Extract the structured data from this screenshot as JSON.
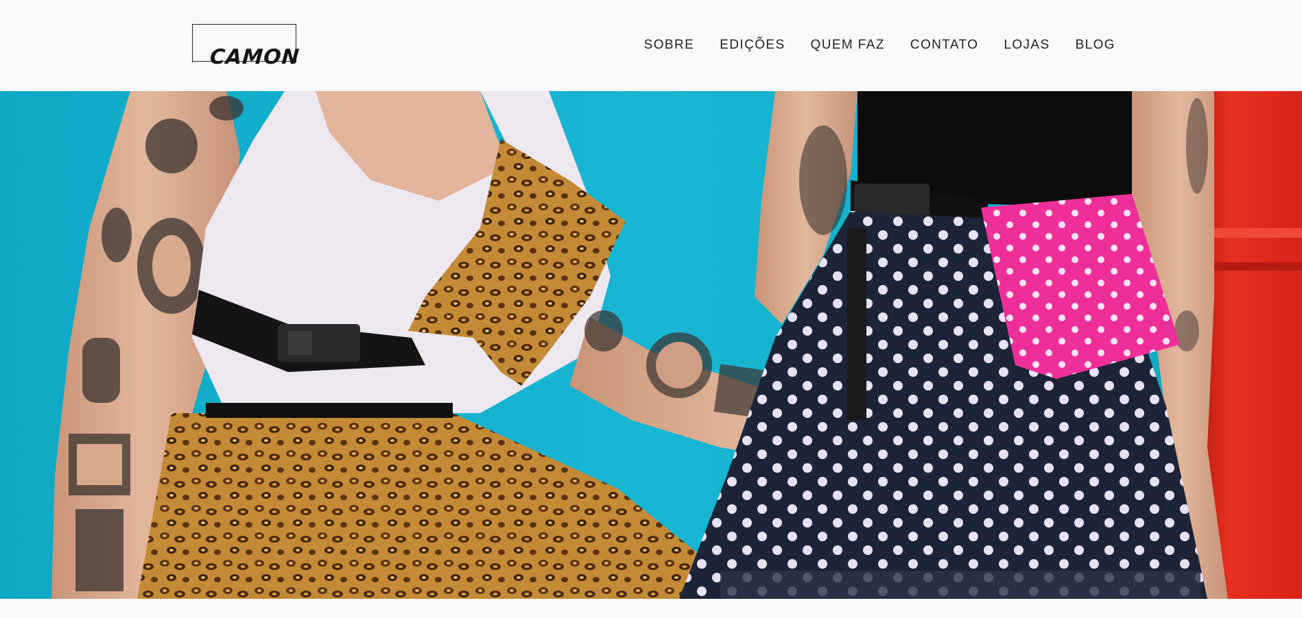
{
  "brand": {
    "logo_text": "CAMON"
  },
  "nav": {
    "items": [
      {
        "label": "SOBRE"
      },
      {
        "label": "EDIÇÕES"
      },
      {
        "label": "QUEM FAZ"
      },
      {
        "label": "CONTATO"
      },
      {
        "label": "LOJAS"
      },
      {
        "label": "BLOG"
      }
    ]
  },
  "hero": {
    "colors": {
      "wall": "#14b3cf",
      "door": "#e0261a",
      "skin": "#d9a98c",
      "top_white": "#ece6ee",
      "top_black": "#0c0c0c",
      "leopard": "#b07a2c",
      "polka_skirt": "#1a2236",
      "pink_bag": "#ee2f9a"
    }
  }
}
